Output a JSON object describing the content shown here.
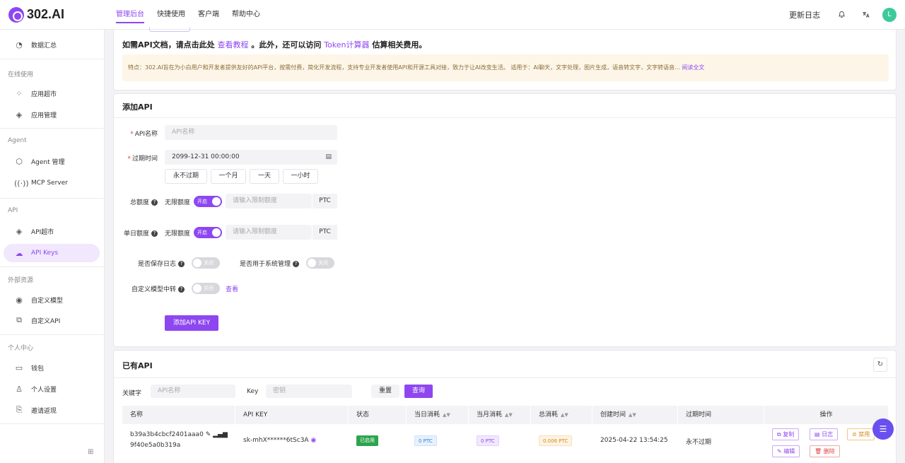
{
  "brand": {
    "name": "302.AI",
    "accent": "#8e47f0"
  },
  "topnav": {
    "items": [
      "管理后台",
      "快捷使用",
      "客户端",
      "帮助中心"
    ],
    "active": "管理后台"
  },
  "header": {
    "changelog": "更新日志",
    "avatar_letter": "L"
  },
  "sidebar": {
    "summary": "数据汇总",
    "groups": {
      "online": "在线使用",
      "agent": "Agent",
      "api": "API",
      "external": "外部资源",
      "personal": "个人中心"
    },
    "items": {
      "app_store": "应用超市",
      "app_manage": "应用管理",
      "agent_manage": "Agent 管理",
      "mcp_server": "MCP Server",
      "api_store": "API超市",
      "api_keys": "API Keys",
      "custom_model": "自定义模型",
      "custom_api": "自定义API",
      "wallet": "钱包",
      "settings": "个人设置",
      "invite": "邀请返现"
    }
  },
  "intro": {
    "text1": "如需API文档，请点击此处",
    "link1": "查看教程",
    "text2": "。此外，还可以访问",
    "link2": "Token计算器",
    "text3": "估算相关费用。",
    "notice": "特点：302.AI旨在为小白用户和开发者提供友好的API平台，按需付费，简化开发流程，支持专业开发者使用API和开源工具对接，致力于让AI改变生活。 适用于：AI聊天，文字处理，图片生成，语音转文字，文字转语音...",
    "read_more": "阅读全文"
  },
  "add_api": {
    "title": "添加API",
    "name_label": "API名称",
    "name_placeholder": "API名称",
    "expire_label": "过期时间",
    "expire_value": "2099-12-31 00:00:00",
    "quick": [
      "永不过期",
      "一个月",
      "一天",
      "一小时"
    ],
    "total_label": "总额度",
    "unlimited_label": "无限额度",
    "toggle_on": "开启",
    "toggle_off": "关闭",
    "quota_placeholder": "请输入限制额度",
    "unit": "PTC",
    "daily_label": "单日额度",
    "save_log_label": "是否保存日志",
    "system_label": "是否用于系统管理",
    "custom_relay_label": "自定义模型中转",
    "view_link": "查看",
    "submit": "添加API KEY"
  },
  "existing": {
    "title": "已有API",
    "keyword_label": "关键字",
    "keyword_placeholder": "API名称",
    "key_label": "Key",
    "key_placeholder": "密钥",
    "reset": "重置",
    "query": "查询",
    "columns": [
      "名称",
      "API KEY",
      "状态",
      "当日消耗",
      "当月消耗",
      "总消耗",
      "创建时间",
      "过期时间",
      "操作"
    ],
    "rows": [
      {
        "name_line1": "b39a3b4cbcf2401aaa0",
        "name_line2": "9f40e5a0b319a",
        "key": "sk-mhX******6tSc3A",
        "status": "已启用",
        "today": "0 PTC",
        "month": "0 PTC",
        "total": "0.006 PTC",
        "created": "2025-04-22 13:54:25",
        "expire": "永不过期",
        "actions": [
          "复制",
          "日志",
          "禁用",
          "编辑",
          "删除"
        ]
      }
    ]
  }
}
